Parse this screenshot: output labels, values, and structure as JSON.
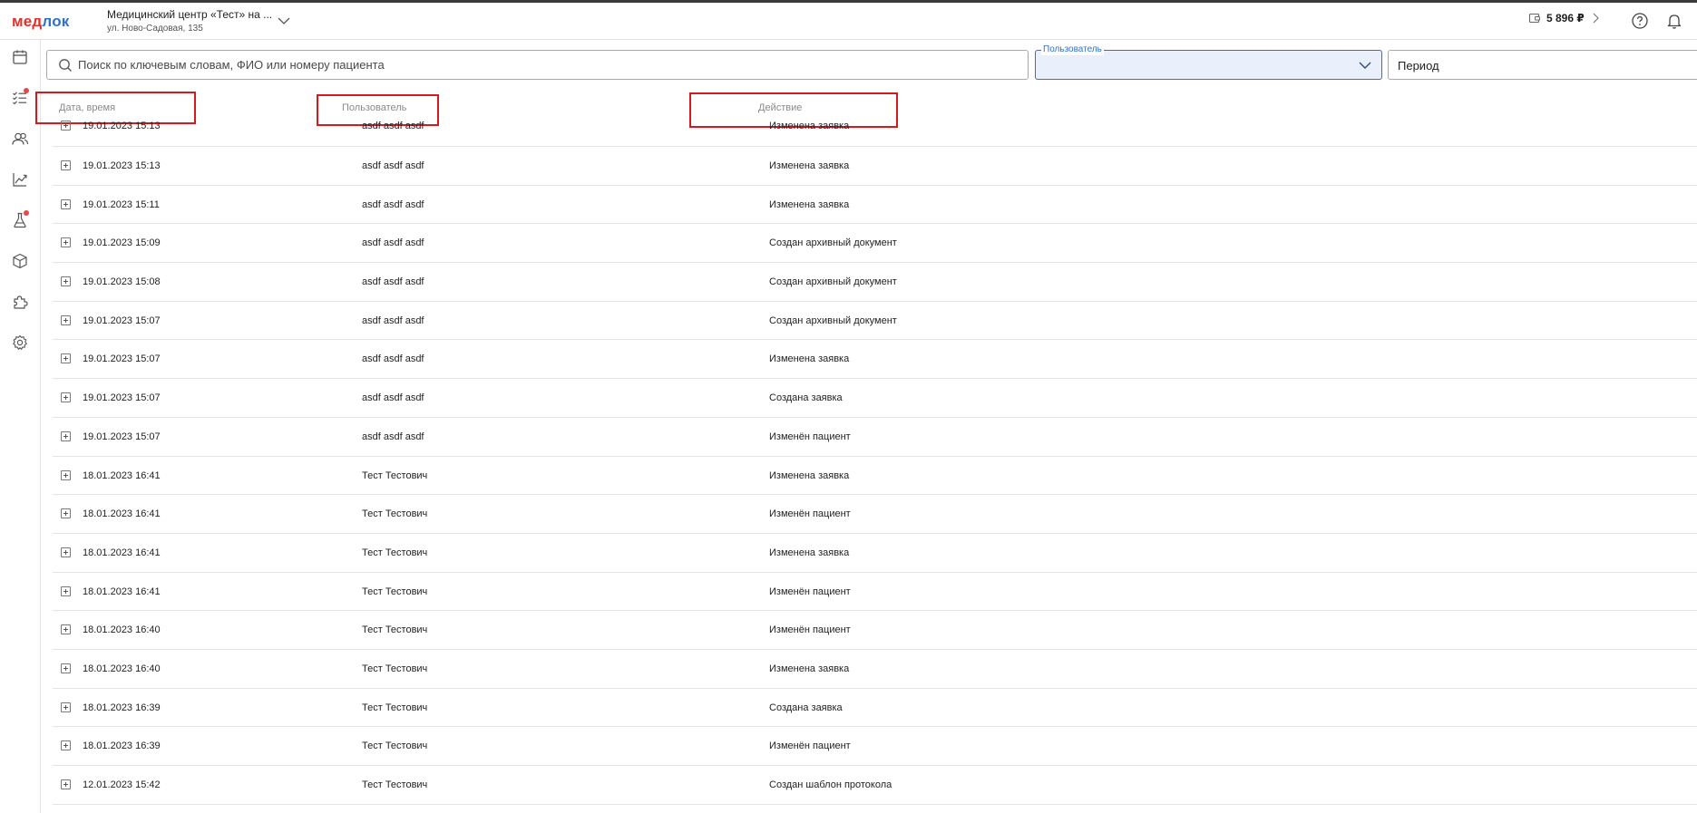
{
  "header": {
    "logo_part1": "мед",
    "logo_part2": "лок",
    "clinic_name": "Медицинский центр «Тест» на ...",
    "clinic_address": "ул. Ново-Садовая, 135",
    "balance": "5 896 ₽"
  },
  "sidebar": {
    "items": [
      {
        "name": "calendar-icon"
      },
      {
        "name": "tasks-icon",
        "badge": true
      },
      {
        "name": "patients-icon"
      },
      {
        "name": "analytics-icon"
      },
      {
        "name": "lab-icon",
        "badge": true
      },
      {
        "name": "warehouse-icon"
      },
      {
        "name": "integrations-icon"
      },
      {
        "name": "settings-icon"
      }
    ]
  },
  "filters": {
    "search_placeholder": "Поиск по ключевым словам, ФИО или номеру пациента",
    "user_label": "Пользователь",
    "period_placeholder": "Период"
  },
  "table": {
    "columns": [
      "Дата, время",
      "Пользователь",
      "Действие"
    ],
    "rows": [
      [
        "19.01.2023 15:13",
        "asdf asdf asdf",
        "Изменена заявка"
      ],
      [
        "19.01.2023 15:13",
        "asdf asdf asdf",
        "Изменена заявка"
      ],
      [
        "19.01.2023 15:11",
        "asdf asdf asdf",
        "Изменена заявка"
      ],
      [
        "19.01.2023 15:09",
        "asdf asdf asdf",
        "Создан архивный документ"
      ],
      [
        "19.01.2023 15:08",
        "asdf asdf asdf",
        "Создан архивный документ"
      ],
      [
        "19.01.2023 15:07",
        "asdf asdf asdf",
        "Создан архивный документ"
      ],
      [
        "19.01.2023 15:07",
        "asdf asdf asdf",
        "Изменена заявка"
      ],
      [
        "19.01.2023 15:07",
        "asdf asdf asdf",
        "Создана заявка"
      ],
      [
        "19.01.2023 15:07",
        "asdf asdf asdf",
        "Изменён пациент"
      ],
      [
        "18.01.2023 16:41",
        "Тест Тестович",
        "Изменена заявка"
      ],
      [
        "18.01.2023 16:41",
        "Тест Тестович",
        "Изменён пациент"
      ],
      [
        "18.01.2023 16:41",
        "Тест Тестович",
        "Изменена заявка"
      ],
      [
        "18.01.2023 16:41",
        "Тест Тестович",
        "Изменён пациент"
      ],
      [
        "18.01.2023 16:40",
        "Тест Тестович",
        "Изменён пациент"
      ],
      [
        "18.01.2023 16:40",
        "Тест Тестович",
        "Изменена заявка"
      ],
      [
        "18.01.2023 16:39",
        "Тест Тестович",
        "Создана заявка"
      ],
      [
        "18.01.2023 16:39",
        "Тест Тестович",
        "Изменён пациент"
      ],
      [
        "12.01.2023 15:42",
        "Тест Тестович",
        "Создан шаблон протокола"
      ]
    ]
  },
  "colors": {
    "brand_red": "#e0322b",
    "brand_blue": "#2f72c9",
    "highlight_box": "#d6191e",
    "select_bg": "#eaf0fb"
  }
}
